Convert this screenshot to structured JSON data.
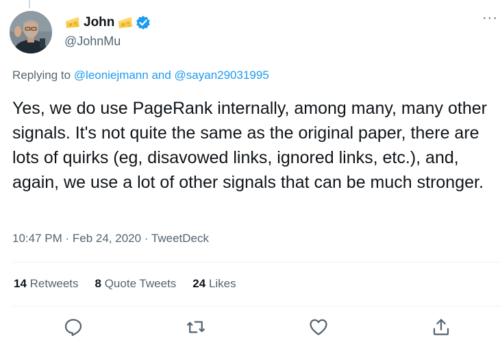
{
  "author": {
    "display_name": "John",
    "handle": "@JohnMu",
    "name_emoji_left": "cheese-emoji",
    "name_emoji_right": "cheese-emoji",
    "verified_icon": "verified-badge-icon",
    "verified_color": "#1d9bf0"
  },
  "more_label": "···",
  "reply_context": {
    "prefix": "Replying to ",
    "mention_1": "@leoniejmann",
    "conjunction": " and ",
    "mention_2": "@sayan29031995"
  },
  "tweet": {
    "text": "Yes, we do use PageRank internally, among many, many other signals. It's not quite the same as the original paper, there are lots of quirks (eg, disavowed links, ignored links, etc.), and, again, we use a lot of other signals that can be much stronger."
  },
  "meta": {
    "time": "10:47 PM",
    "separator": " · ",
    "date": "Feb 24, 2020",
    "source": "TweetDeck"
  },
  "stats": {
    "retweets_count": "14",
    "retweets_label": " Retweets",
    "quotes_count": "8",
    "quotes_label": " Quote Tweets",
    "likes_count": "24",
    "likes_label": " Likes"
  },
  "actions": [
    "reply-icon",
    "retweet-icon",
    "like-icon",
    "share-icon"
  ],
  "colors": {
    "accent": "#1d9bf0",
    "secondary_text": "#536471",
    "primary_text": "#0f1419",
    "divider": "#eff3f4"
  }
}
